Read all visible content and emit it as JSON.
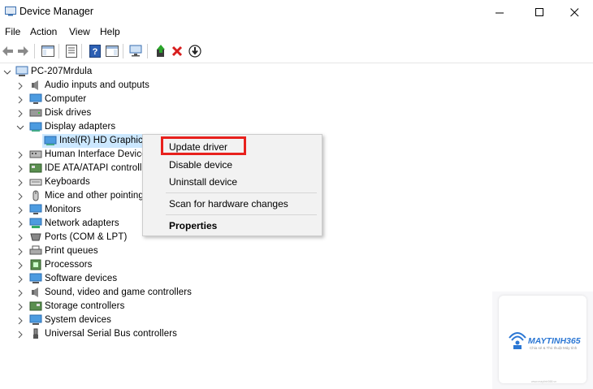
{
  "window": {
    "title": "Device Manager",
    "min_glyph": "—",
    "max_glyph": "☐",
    "close_glyph": "✕"
  },
  "menu": [
    "File",
    "Action",
    "View",
    "Help"
  ],
  "tree": {
    "root": "PC-207Mrdula",
    "items": [
      "Audio inputs and outputs",
      "Computer",
      "Disk drives",
      "Display adapters",
      "Intel(R) HD Graphics",
      "Human Interface Device",
      "IDE ATA/ATAPI controller",
      "Keyboards",
      "Mice and other pointing",
      "Monitors",
      "Network adapters",
      "Ports (COM & LPT)",
      "Print queues",
      "Processors",
      "Software devices",
      "Sound, video and game controllers",
      "Storage controllers",
      "System devices",
      "Universal Serial Bus controllers"
    ]
  },
  "context_menu": {
    "update_driver": "Update driver",
    "disable_device": "Disable device",
    "uninstall_device": "Uninstall device",
    "scan": "Scan for hardware changes",
    "properties": "Properties"
  },
  "watermark": {
    "brand": "MAYTINH365",
    "tagline": "Chia sẻ & Thủ thuật Máy tính",
    "url": "www.maytinh365.vn"
  },
  "colors": {
    "highlight_border": "#e8211d",
    "selected_row": "#cce8ff"
  }
}
